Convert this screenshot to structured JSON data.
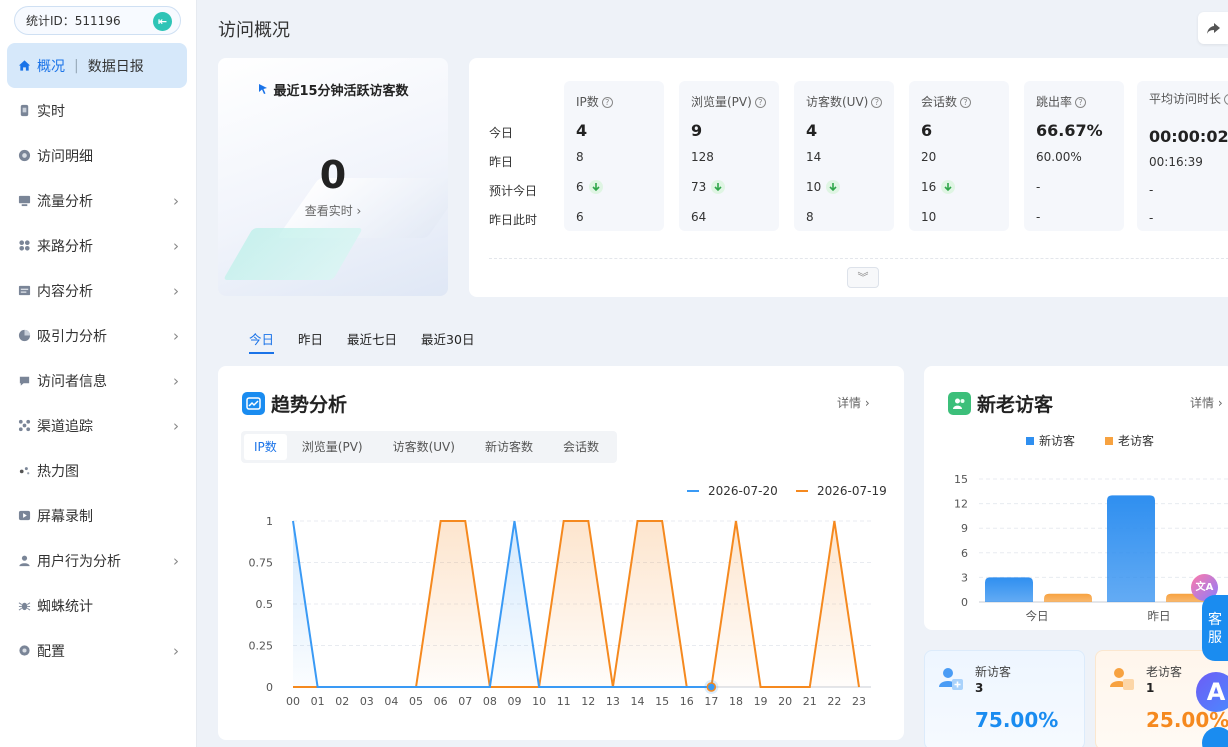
{
  "sidebar": {
    "stat_id": "统计ID：511196",
    "items": [
      {
        "label": "概况",
        "sub": "数据日报",
        "icon": "home-icon"
      },
      {
        "label": "实时",
        "icon": "realtime-icon"
      },
      {
        "label": "访问明细",
        "icon": "visit-detail-icon"
      },
      {
        "label": "流量分析",
        "icon": "traffic-icon"
      },
      {
        "label": "来路分析",
        "icon": "source-icon"
      },
      {
        "label": "内容分析",
        "icon": "content-icon"
      },
      {
        "label": "吸引力分析",
        "icon": "attraction-icon"
      },
      {
        "label": "访问者信息",
        "icon": "visitor-info-icon"
      },
      {
        "label": "渠道追踪",
        "icon": "channel-icon"
      },
      {
        "label": "热力图",
        "icon": "heatmap-icon"
      },
      {
        "label": "屏幕录制",
        "icon": "screen-record-icon"
      },
      {
        "label": "用户行为分析",
        "icon": "user-behavior-icon"
      },
      {
        "label": "蜘蛛统计",
        "icon": "spider-icon"
      },
      {
        "label": "配置",
        "icon": "settings-icon"
      }
    ]
  },
  "header": {
    "title": "访问概况"
  },
  "active_visitors": {
    "title": "最近15分钟活跃访客数",
    "count": "0",
    "link": "查看实时 ›"
  },
  "metrics": {
    "row_labels": [
      "今日",
      "昨日",
      "预计今日",
      "昨日此时"
    ],
    "columns": [
      {
        "label": "IP数",
        "today": "4",
        "yesterday": "8",
        "forecast": "6",
        "forecast_down": true,
        "same_time": "6"
      },
      {
        "label": "浏览量(PV)",
        "today": "9",
        "yesterday": "128",
        "forecast": "73",
        "forecast_down": true,
        "same_time": "64"
      },
      {
        "label": "访客数(UV)",
        "today": "4",
        "yesterday": "14",
        "forecast": "10",
        "forecast_down": true,
        "same_time": "8"
      },
      {
        "label": "会话数",
        "today": "6",
        "yesterday": "20",
        "forecast": "16",
        "forecast_down": true,
        "same_time": "10"
      },
      {
        "label": "跳出率",
        "today": "66.67%",
        "yesterday": "60.00%",
        "forecast": "-",
        "forecast_down": false,
        "same_time": "-"
      },
      {
        "label": "平均访问时长",
        "today": "00:00:02",
        "yesterday": "00:16:39",
        "forecast": "-",
        "forecast_down": false,
        "same_time": "-"
      }
    ],
    "expand_icon": "double-chevron-down-icon"
  },
  "time_tabs": [
    "今日",
    "昨日",
    "最近七日",
    "最近30日"
  ],
  "trend": {
    "title": "趋势分析",
    "detail": "详情 ›",
    "tabs": [
      "IP数",
      "浏览量(PV)",
      "访客数(UV)",
      "新访客数",
      "会话数"
    ],
    "chart_data": {
      "type": "line",
      "x": [
        "00",
        "01",
        "02",
        "03",
        "04",
        "05",
        "06",
        "07",
        "08",
        "09",
        "10",
        "11",
        "12",
        "13",
        "14",
        "15",
        "16",
        "17",
        "18",
        "19",
        "20",
        "21",
        "22",
        "23"
      ],
      "ylim": [
        0,
        1
      ],
      "yticks": [
        "0",
        "0.25",
        "0.5",
        "0.75",
        "1"
      ],
      "series": [
        {
          "name": "2026-07-20",
          "color": "#3a9af5",
          "values": [
            1,
            0,
            0,
            0,
            0,
            0,
            0,
            0,
            0,
            1,
            0,
            0,
            0,
            0,
            0,
            0,
            0,
            0,
            null,
            null,
            null,
            null,
            null,
            null
          ]
        },
        {
          "name": "2026-07-19",
          "color": "#f5891f",
          "values": [
            0,
            0,
            0,
            0,
            0,
            0,
            1,
            1,
            0,
            0,
            0,
            1,
            1,
            0,
            1,
            1,
            0,
            0,
            1,
            0,
            0,
            0,
            1,
            0
          ]
        }
      ]
    }
  },
  "new_old": {
    "title": "新老访客",
    "detail": "详情 ›",
    "legend": [
      "新访客",
      "老访客"
    ],
    "chart_data": {
      "type": "bar",
      "categories": [
        "今日",
        "昨日"
      ],
      "ylim": [
        0,
        15
      ],
      "yticks": [
        "0",
        "3",
        "6",
        "9",
        "12",
        "15"
      ],
      "series": [
        {
          "name": "新访客",
          "color": "#2f8ff0",
          "values": [
            3,
            13
          ]
        },
        {
          "name": "老访客",
          "color": "#f7a240",
          "values": [
            1,
            1
          ]
        }
      ]
    },
    "new_box": {
      "label": "新访客",
      "count": "3",
      "pct": "75.00%"
    },
    "old_box": {
      "label": "老访客",
      "count": "1",
      "pct": "25.00%"
    }
  },
  "floating": {
    "service": "客服",
    "ai": "A",
    "translate": "文A"
  }
}
